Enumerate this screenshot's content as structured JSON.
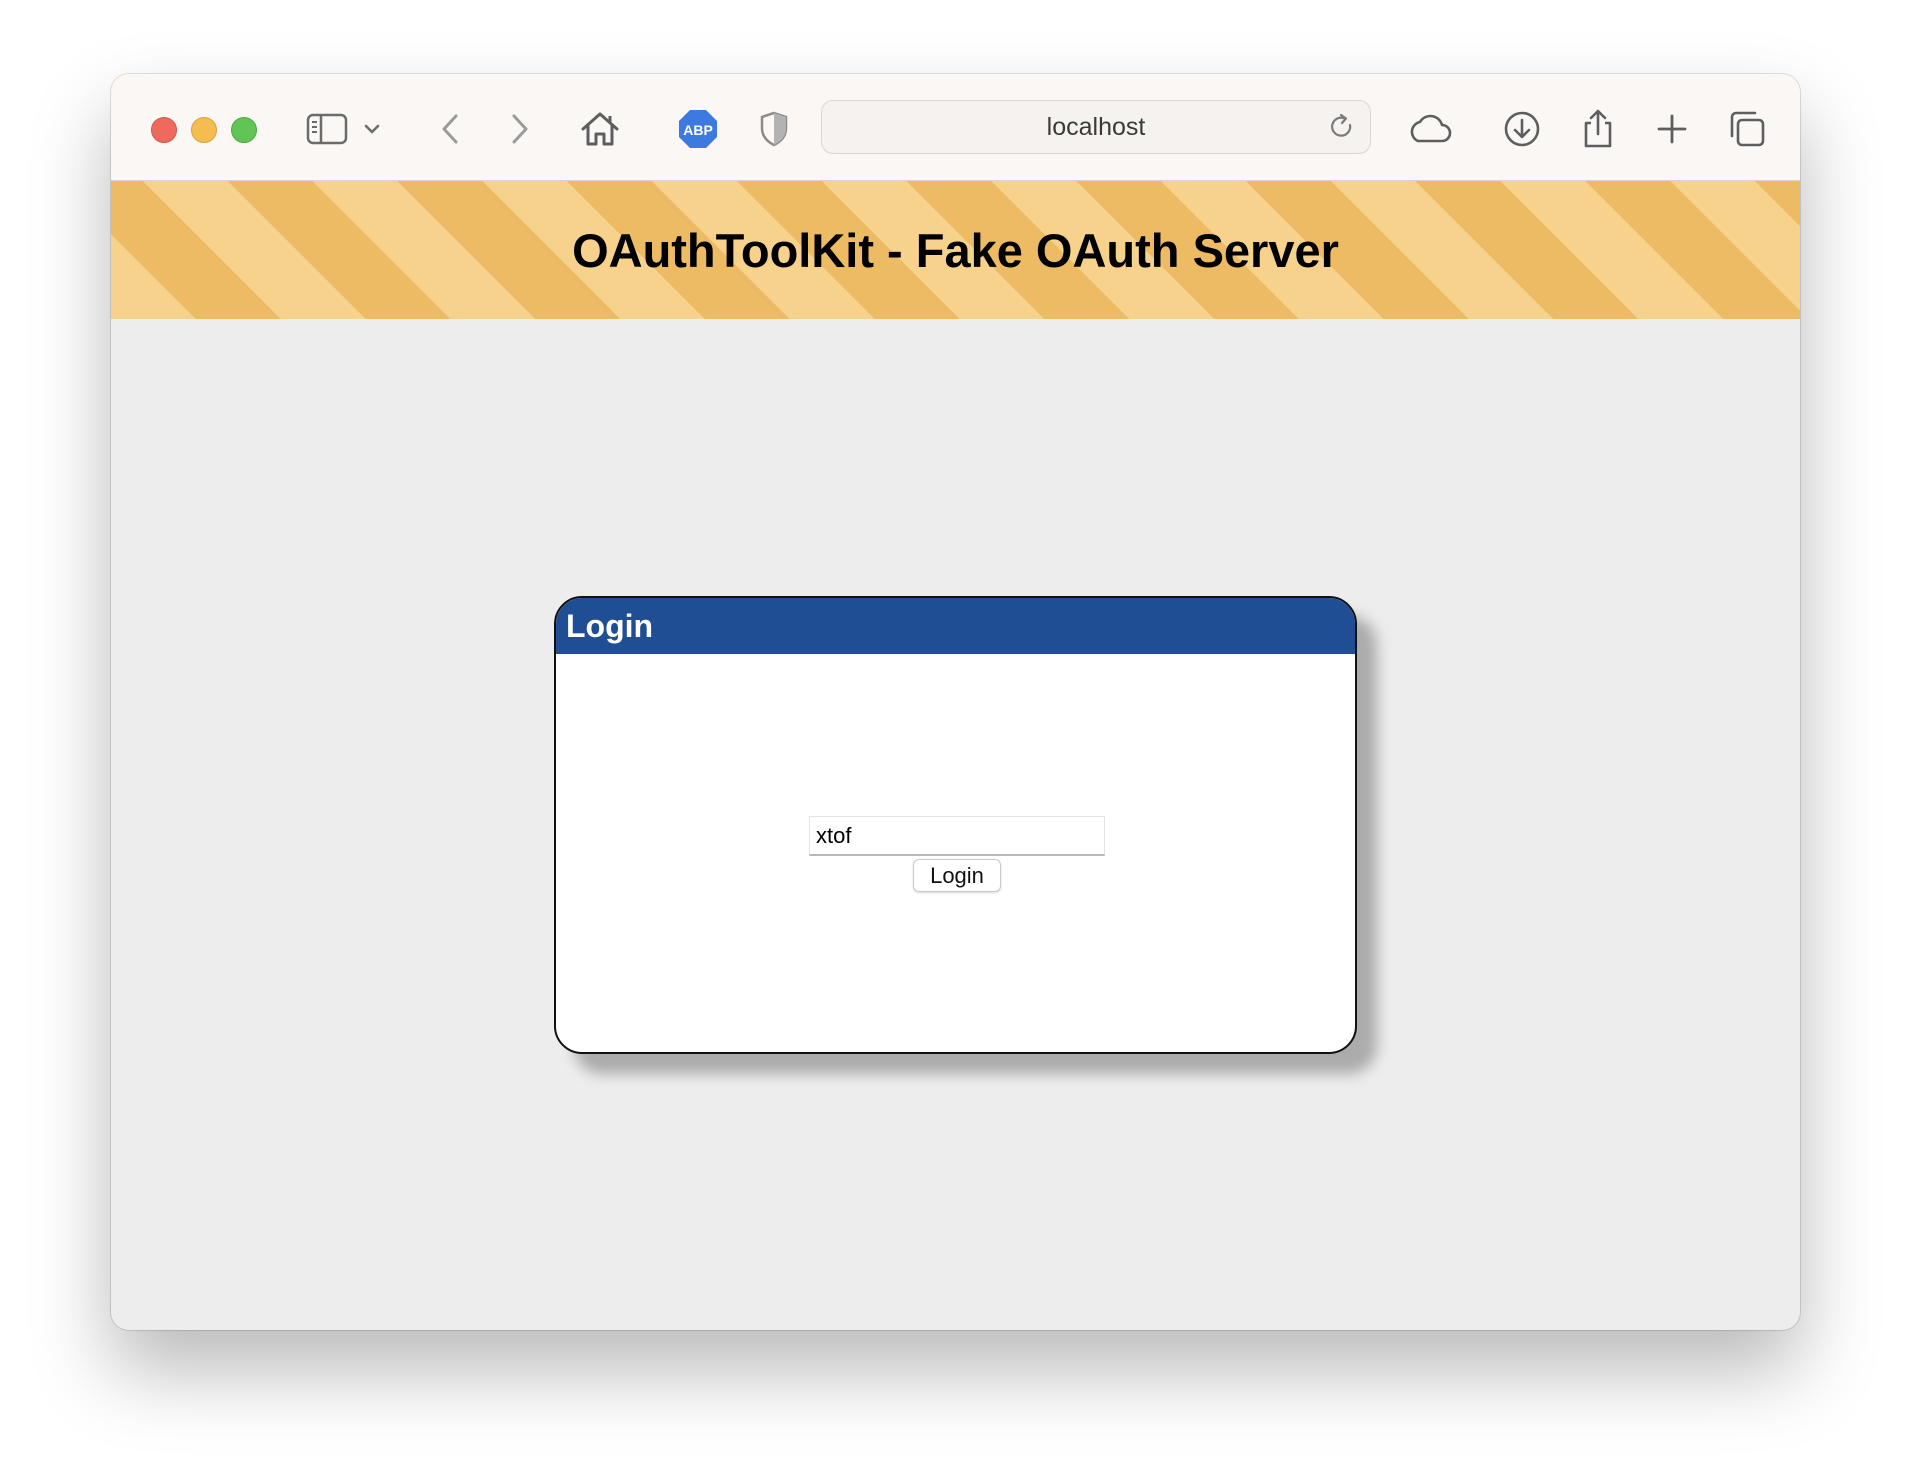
{
  "browser": {
    "address": "localhost",
    "toolbar_icons": [
      "sidebar-icon",
      "chevron-down-icon",
      "back-icon",
      "forward-icon",
      "home-icon",
      "adblock-icon",
      "shield-icon",
      "reload-icon",
      "cloud-icon",
      "download-icon",
      "share-icon",
      "plus-icon",
      "tabs-icon"
    ],
    "adblock_label": "ABP"
  },
  "page": {
    "banner_title": "OAuthToolKit - Fake OAuth Server",
    "colors": {
      "stripe_light": "#f7d28c",
      "stripe_dark": "#edbb63",
      "dialog_header": "#204e95",
      "background": "#ededed"
    }
  },
  "login": {
    "title": "Login",
    "username_value": "xtof",
    "button_label": "Login"
  }
}
